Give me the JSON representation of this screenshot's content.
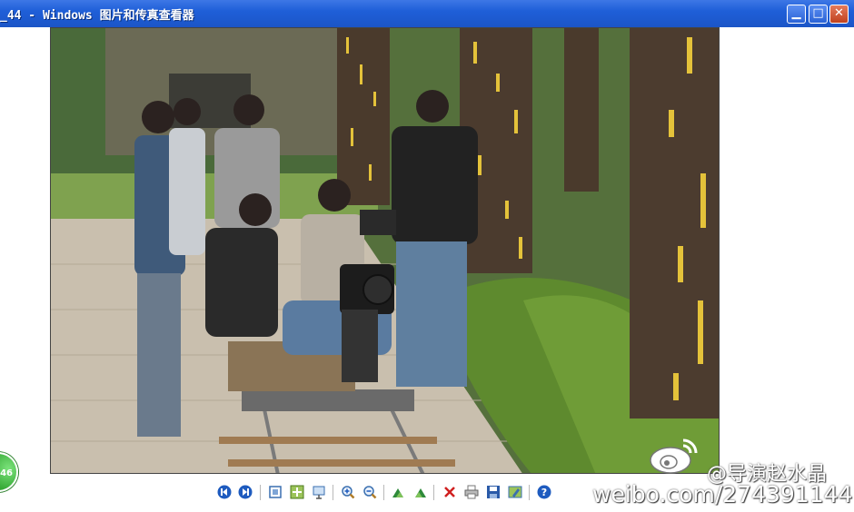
{
  "window": {
    "title": "_44 - Windows 图片和传真查看器",
    "buttons": [
      "minimize",
      "maximize",
      "close"
    ]
  },
  "badge": {
    "text": "46"
  },
  "toolbar": {
    "items": [
      {
        "name": "previous-image",
        "icon": "previous-icon"
      },
      {
        "name": "next-image",
        "icon": "next-icon"
      },
      {
        "name": "best-fit",
        "icon": "best-fit-icon"
      },
      {
        "name": "actual-size",
        "icon": "actual-size-icon"
      },
      {
        "name": "slideshow",
        "icon": "slideshow-icon"
      },
      {
        "name": "zoom-in",
        "icon": "zoom-in-icon"
      },
      {
        "name": "zoom-out",
        "icon": "zoom-out-icon"
      },
      {
        "name": "rotate-clockwise",
        "icon": "rotate-cw-icon"
      },
      {
        "name": "rotate-counterclockwise",
        "icon": "rotate-ccw-icon"
      },
      {
        "name": "delete",
        "icon": "delete-icon"
      },
      {
        "name": "print",
        "icon": "print-icon"
      },
      {
        "name": "save",
        "icon": "save-icon"
      },
      {
        "name": "open-for-editing",
        "icon": "edit-icon"
      },
      {
        "name": "help",
        "icon": "help-icon"
      }
    ]
  },
  "watermark": {
    "name": "@导演赵水晶",
    "url": "weibo.com/274391144"
  },
  "colors": {
    "titlebar": "#1f5fd8",
    "accent_green": "#2a9f2a",
    "delete_red": "#d02020",
    "help_blue": "#1e5bbf"
  }
}
